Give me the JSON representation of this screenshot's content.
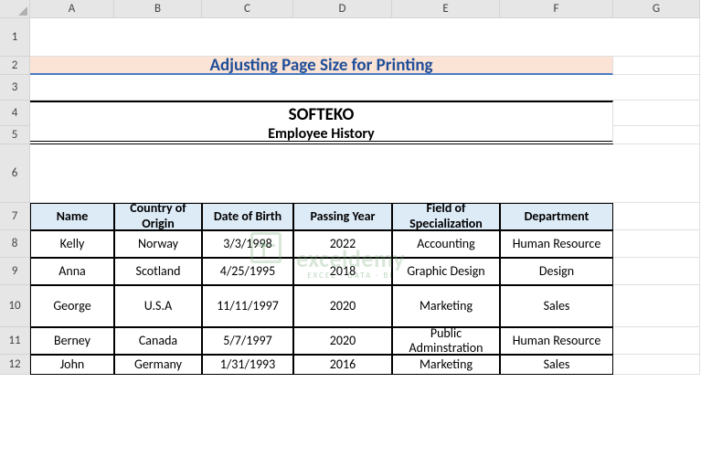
{
  "cols": [
    "A",
    "B",
    "C",
    "D",
    "E",
    "F",
    "G"
  ],
  "rows": [
    "1",
    "2",
    "3",
    "4",
    "5",
    "6",
    "7",
    "8",
    "9",
    "10",
    "11",
    "12"
  ],
  "banner": "Adjusting Page Size for Printing",
  "company": "SOFTEKO",
  "subtitle": "Employee History",
  "headers": {
    "name": "Name",
    "country": "Country of Origin",
    "dob": "Date of Birth",
    "passyear": "Passing Year",
    "field": "Field of Specialization",
    "dept": "Department"
  },
  "chart_data": {
    "type": "table",
    "title": "Employee History",
    "columns": [
      "Name",
      "Country of Origin",
      "Date of Birth",
      "Passing Year",
      "Field of Specialization",
      "Department"
    ],
    "rows": [
      {
        "name": "Kelly",
        "country": "Norway",
        "dob": "3/3/1998",
        "passyear": "2022",
        "field": "Accounting",
        "dept": "Human Resource"
      },
      {
        "name": "Anna",
        "country": "Scotland",
        "dob": "4/25/1995",
        "passyear": "2018",
        "field": "Graphic Design",
        "dept": "Design"
      },
      {
        "name": "George",
        "country": "U.S.A",
        "dob": "11/11/1997",
        "passyear": "2020",
        "field": "Marketing",
        "dept": "Sales"
      },
      {
        "name": "Berney",
        "country": "Canada",
        "dob": "5/7/1997",
        "passyear": "2020",
        "field": "Public Adminstration",
        "dept": "Human Resource"
      },
      {
        "name": "John",
        "country": "Germany",
        "dob": "1/31/1993",
        "passyear": "2016",
        "field": "Marketing",
        "dept": "Sales"
      }
    ]
  },
  "watermark": {
    "text": "exceldemy",
    "sub": "EXCEL · DATA · BI"
  }
}
